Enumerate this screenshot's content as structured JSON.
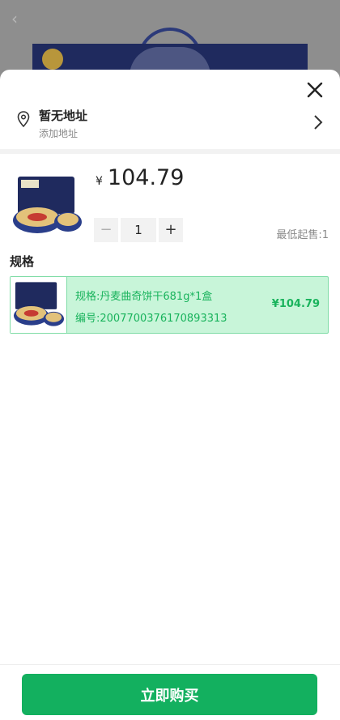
{
  "address": {
    "title": "暂无地址",
    "subtitle": "添加地址"
  },
  "product": {
    "currency": "¥",
    "price": "104.79",
    "quantity": "1",
    "min_sale_label": "最低起售:1"
  },
  "spec": {
    "heading": "规格",
    "selected": {
      "name": "规格:丹麦曲奇饼干681g*1盒",
      "code": "编号:2007700376170893313",
      "price": "¥104.79"
    }
  },
  "actions": {
    "buy_now": "立即购买"
  },
  "colors": {
    "accent": "#13b05f",
    "selected_bg": "#c8f5d9",
    "selected_text": "#19b35c"
  },
  "icons": [
    "back-arrow-icon",
    "close-icon",
    "location-pin-icon",
    "chevron-right-icon",
    "minus-icon",
    "plus-icon"
  ]
}
